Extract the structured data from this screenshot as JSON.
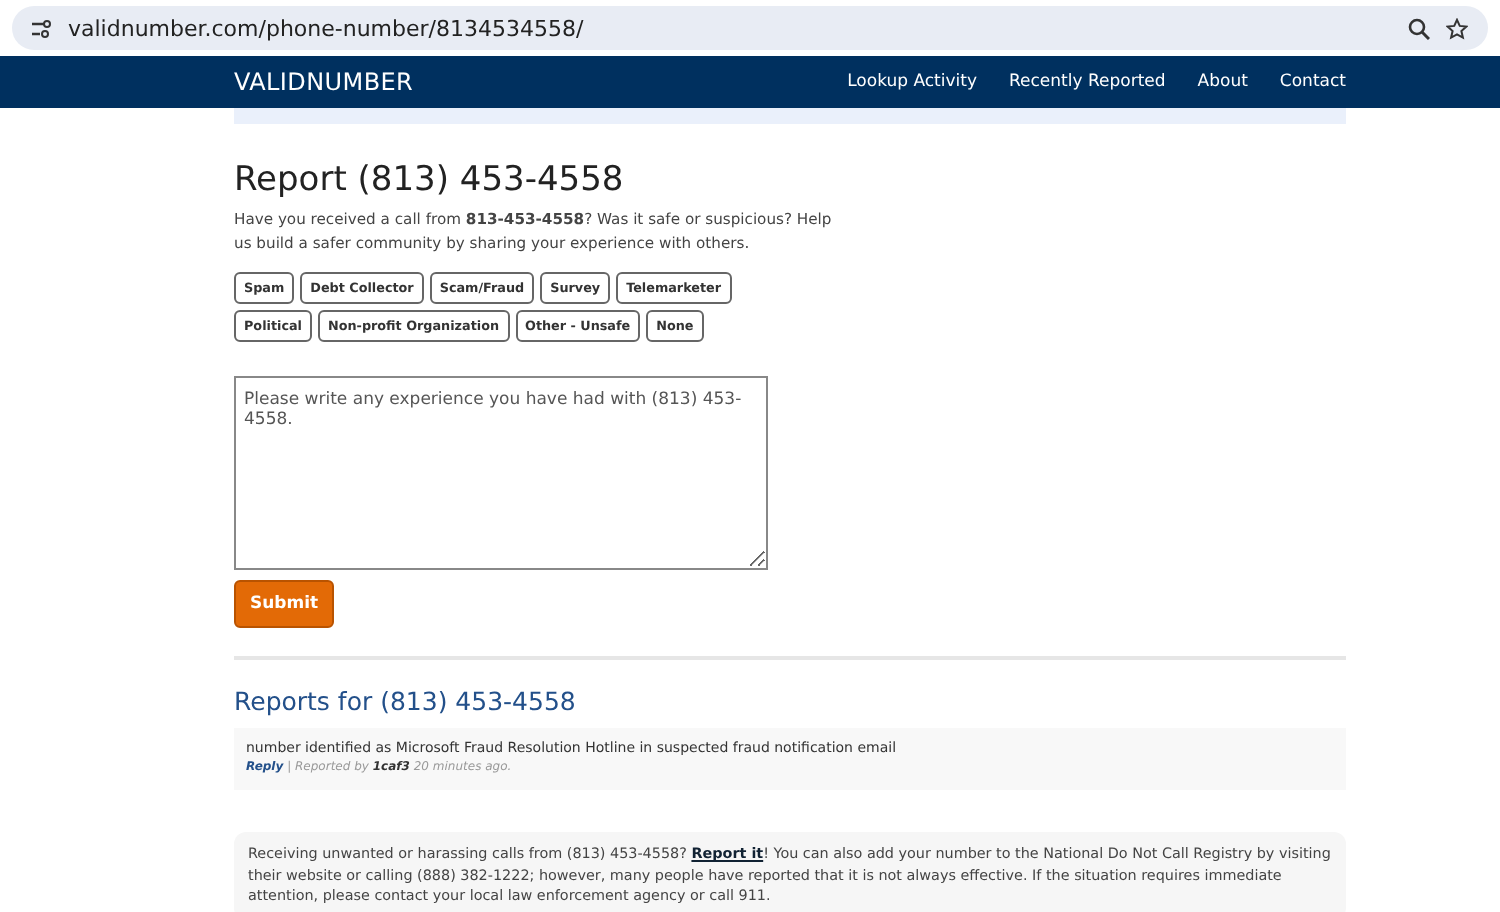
{
  "browser": {
    "url": "validnumber.com/phone-number/8134534558/"
  },
  "nav": {
    "logo": "VALIDNUMBER",
    "links": [
      "Lookup Activity",
      "Recently Reported",
      "About",
      "Contact"
    ]
  },
  "report": {
    "title": "Report (813) 453-4558",
    "intro": "Have you received a call from **813-453-4558**? Was it safe or suspicious? Help us build a safer community by sharing your experience with others.",
    "tags": [
      {
        "label": "Spam",
        "selected": false
      },
      {
        "label": "Debt Collector",
        "selected": false
      },
      {
        "label": "Scam/Fraud",
        "selected": false
      },
      {
        "label": "Survey",
        "selected": false
      },
      {
        "label": "Telemarketer",
        "selected": false
      },
      {
        "label": "Political",
        "selected": false
      },
      {
        "label": "Non-profit Organization",
        "selected": false
      },
      {
        "label": "Other - Unsafe",
        "selected": false
      },
      {
        "label": "None",
        "selected": false
      }
    ],
    "placeholder": "Please write any experience you have had with (813) 453-4558.",
    "submit": "Submit"
  },
  "reports": {
    "title": "Reports for (813) 453-4558",
    "items": [
      {
        "text": "number identified as Microsoft Fraud Resolution Hotline in suspected fraud notification email",
        "reply": "Reply",
        "by_prefix": "| Reported by",
        "author": "1caf3",
        "time": "20 minutes ago."
      }
    ]
  },
  "notice": {
    "before": "Receiving unwanted or harassing calls from (813) 453-4558?",
    "link": "Report it",
    "after": "! You can also add your number to the National Do Not Call Registry by visiting their website or calling (888) 382-1222; however, many people have reported that it is not always effective. If the situation requires immediate attention, please contact your local law enforcement agency or call 911."
  }
}
